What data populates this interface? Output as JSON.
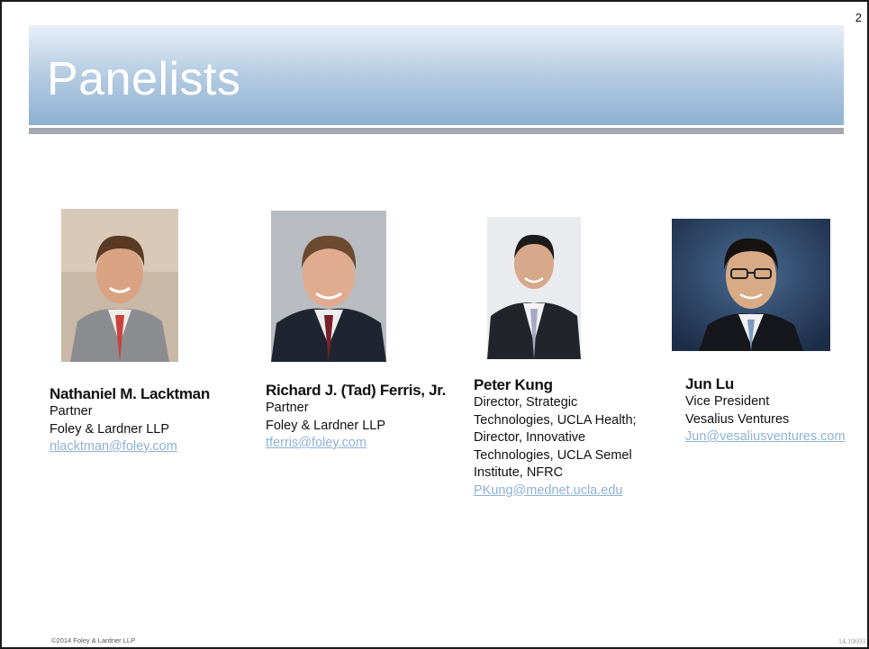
{
  "slide": {
    "number": "2",
    "title": "Panelists",
    "footer_copyright": "©2014 Foley & Lardner LLP",
    "footer_code": "14.10693"
  },
  "panelists": [
    {
      "name": "Nathaniel M. Lacktman",
      "lines": [
        "Partner",
        "Foley & Lardner LLP"
      ],
      "email": "nlacktman@foley.com"
    },
    {
      "name": "Richard J. (Tad) Ferris, Jr.",
      "lines": [
        "Partner",
        "Foley & Lardner LLP"
      ],
      "email": "tferris@foley.com"
    },
    {
      "name": "Peter Kung",
      "lines": [
        "Director, Strategic",
        "Technologies, UCLA Health;",
        "Director, Innovative",
        "Technologies, UCLA Semel",
        "Institute, NFRC"
      ],
      "email": "PKung@mednet.ucla.edu"
    },
    {
      "name": "Jun Lu",
      "lines": [
        "Vice President",
        "Vesalius Ventures"
      ],
      "email": "Jun@vesaliusventures.com"
    }
  ],
  "colors": {
    "title_text": "#ffffff",
    "link": "#8fb1d6",
    "rule": "#a3a9b0"
  }
}
